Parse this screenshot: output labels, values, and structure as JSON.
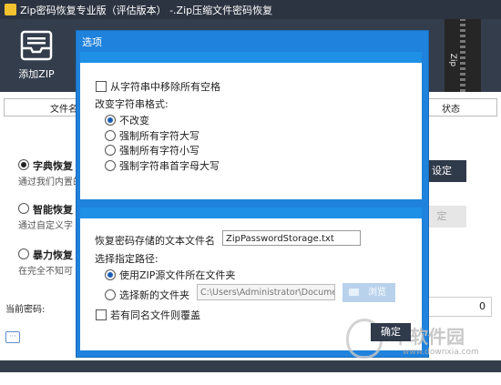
{
  "window": {
    "title": "Zip密码恢复专业版（评估版本） -.Zip压缩文件密码恢复"
  },
  "toolbar": {
    "add_zip_label": "添加ZIP",
    "zipper_label": "Zip"
  },
  "columns": {
    "filename": "文件名",
    "status": "状态"
  },
  "methods": [
    {
      "label": "字典恢复",
      "desc": "通过我们内置的",
      "selected": true
    },
    {
      "label": "智能恢复",
      "desc": "通过自定义字",
      "selected": false
    },
    {
      "label": "暴力恢复",
      "desc": "在完全不知可",
      "selected": false
    }
  ],
  "set_button": "设定",
  "set_button2": "定",
  "current_password": {
    "label": "当前密码:",
    "value": "0"
  },
  "dialog": {
    "title": "选项",
    "remove_spaces_label": "从字符串中移除所有空格",
    "format_label": "改变字符串格式:",
    "format_options": [
      {
        "label": "不改变",
        "selected": true
      },
      {
        "label": "强制所有字符大写",
        "selected": false
      },
      {
        "label": "强制所有字符小写",
        "selected": false
      },
      {
        "label": "强制字符串首字母大写",
        "selected": false
      }
    ],
    "filename_label": "恢复密码存储的文本文件名",
    "filename_value": "ZipPasswordStorage.txt",
    "path_label": "选择指定路径:",
    "path_options": [
      {
        "label": "使用ZIP源文件所在文件夹",
        "selected": true
      },
      {
        "label": "选择新的文件夹",
        "selected": false
      }
    ],
    "path_value": "C:\\Users\\Administrator\\Document",
    "browse_label": "浏览",
    "overwrite_label": "若有同名文件则覆盖",
    "ok_label": "确定"
  },
  "watermark": {
    "main": "下软件园",
    "sub": "www.downxia.com"
  },
  "colors": {
    "titlebar": "#2c3441",
    "dialog_blue": "#1f82dc",
    "button_dark": "#2f3a4a"
  }
}
